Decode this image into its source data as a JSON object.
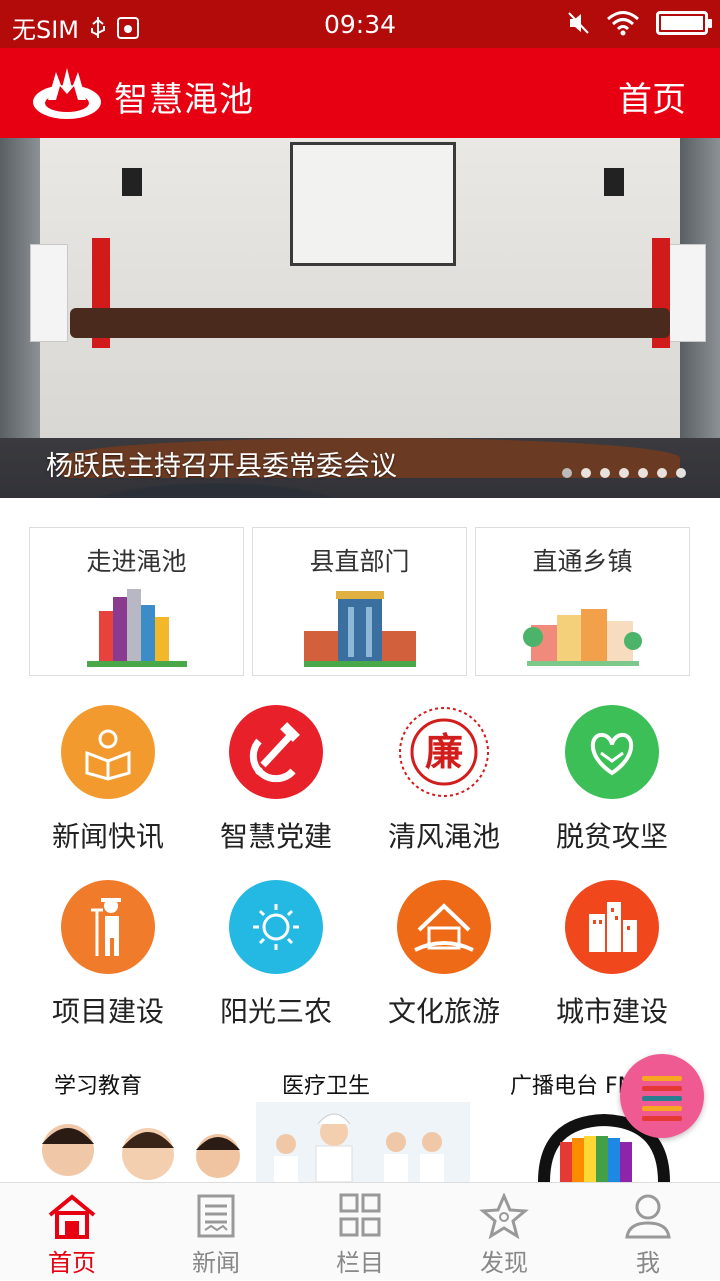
{
  "status_bar": {
    "carrier": "无SIM",
    "time": "09:34"
  },
  "header": {
    "title": "智慧渑池",
    "home_label": "首页",
    "brand_color": "#e60012"
  },
  "banner": {
    "caption": "杨跃民主持召开县委常委会议",
    "slide_count": 7,
    "active_slide": 1
  },
  "cards": [
    {
      "label": "走进渑池",
      "icon": "city-buildings-illustration"
    },
    {
      "label": "县直部门",
      "icon": "government-building-illustration"
    },
    {
      "label": "直通乡镇",
      "icon": "town-houses-illustration"
    }
  ],
  "grid": [
    {
      "label": "新闻快讯",
      "icon": "reading-book-icon",
      "color": "#f29a2e"
    },
    {
      "label": "智慧党建",
      "icon": "hammer-sickle-icon",
      "color": "#e8202a"
    },
    {
      "label": "清风渑池",
      "icon": "lian-seal-icon",
      "color": "#d21d1d"
    },
    {
      "label": "脱贫攻坚",
      "icon": "heart-hands-icon",
      "color": "#3dbf57"
    },
    {
      "label": "项目建设",
      "icon": "farmer-icon",
      "color": "#f07b2b"
    },
    {
      "label": "阳光三农",
      "icon": "sun-icon",
      "color": "#23b9e3"
    },
    {
      "label": "文化旅游",
      "icon": "house-icon",
      "color": "#ef6a17"
    },
    {
      "label": "城市建设",
      "icon": "city-icon",
      "color": "#f0471c"
    }
  ],
  "strip": [
    {
      "label": "学习教育"
    },
    {
      "label": "医疗卫生"
    },
    {
      "label": "广播电台 FM"
    }
  ],
  "tabs": [
    {
      "label": "首页",
      "icon": "home-icon",
      "active": true
    },
    {
      "label": "新闻",
      "icon": "news-icon",
      "active": false
    },
    {
      "label": "栏目",
      "icon": "grid-icon",
      "active": false
    },
    {
      "label": "发现",
      "icon": "discover-star-icon",
      "active": false
    },
    {
      "label": "我",
      "icon": "user-icon",
      "active": false
    }
  ]
}
